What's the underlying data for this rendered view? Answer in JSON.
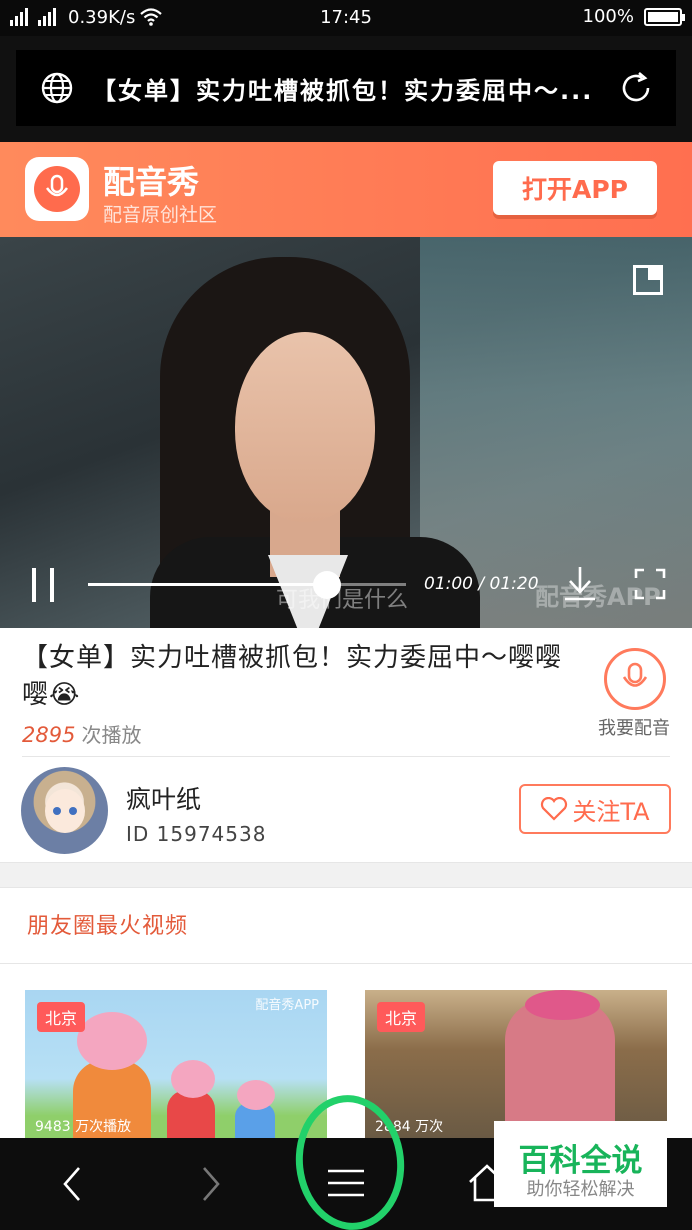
{
  "status_bar": {
    "network": "4G 3G",
    "speed": "0.39K/s",
    "time": "17:45",
    "battery": "100%",
    "battery_level": 1.0
  },
  "browser": {
    "page_title": "【女单】实力吐槽被抓包！实力委屈中～...",
    "globe_icon": "globe-icon",
    "reload_icon": "reload-icon"
  },
  "app_banner": {
    "name": "配音秀",
    "subtitle": "配音原创社区",
    "open_button": "打开APP"
  },
  "video": {
    "subtitle": "可我们是什么",
    "watermark": "配音秀APP",
    "time": "01:00 / 01:20",
    "progress": 0.75
  },
  "info": {
    "title": "【女单】实力吐槽被抓包！实力委屈中～嘤嘤嘤😭",
    "play_count": "2895",
    "play_suffix": "次播放",
    "dub_label": "我要配音"
  },
  "user": {
    "name": "疯叶纸",
    "id": "ID 15974538",
    "follow_button": "关注TA"
  },
  "section": {
    "title": "朋友圈最火视频"
  },
  "cards": [
    {
      "tag": "北京",
      "mark": "配音秀APP",
      "caption": "9483 万次播放"
    },
    {
      "tag": "北京",
      "mark": "",
      "caption": "2884 万次"
    }
  ],
  "badge": {
    "title": "百科全说",
    "subtitle": "助你轻松解决"
  },
  "colors": {
    "accent": "#ff6b4d",
    "highlight_circle": "#22d16a",
    "badge_green": "#18b45a"
  }
}
